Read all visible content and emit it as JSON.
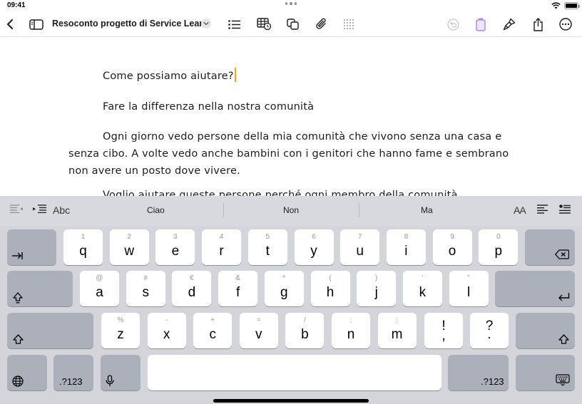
{
  "status_bar": {
    "time": "09:41"
  },
  "toolbar": {
    "document_title": "Resoconto progetto di Service Lear..."
  },
  "document": {
    "paragraphs": [
      "Come possiamo aiutare?",
      "Fare la differenza nella nostra comunità",
      "Ogni giorno vedo persone della mia comunità che vivono senza una casa e senza cibo. A volte vedo anche bambini con i genitori che hanno fame e sembrano non avere un posto dove vivere."
    ],
    "partial_paragraph": "Voglio aiutare queste persone perché ogni membro della comunità"
  },
  "keyboard": {
    "suggestions": {
      "abc_label": "Abc",
      "words": [
        "Ciao",
        "Non",
        "Ma"
      ],
      "text_size_label": "AA"
    },
    "row1": [
      {
        "main": "q",
        "sec": "1"
      },
      {
        "main": "w",
        "sec": "2"
      },
      {
        "main": "e",
        "sec": "3"
      },
      {
        "main": "r",
        "sec": "4"
      },
      {
        "main": "t",
        "sec": "5"
      },
      {
        "main": "y",
        "sec": "6"
      },
      {
        "main": "u",
        "sec": "7"
      },
      {
        "main": "i",
        "sec": "8"
      },
      {
        "main": "o",
        "sec": "9"
      },
      {
        "main": "p",
        "sec": "0"
      }
    ],
    "row2": [
      {
        "main": "a",
        "sec": "@"
      },
      {
        "main": "s",
        "sec": "#"
      },
      {
        "main": "d",
        "sec": "€"
      },
      {
        "main": "f",
        "sec": "&"
      },
      {
        "main": "g",
        "sec": "*"
      },
      {
        "main": "h",
        "sec": "("
      },
      {
        "main": "j",
        "sec": ")"
      },
      {
        "main": "k",
        "sec": "’"
      },
      {
        "main": "l",
        "sec": "”"
      }
    ],
    "row3": [
      {
        "main": "z",
        "sec": "%"
      },
      {
        "main": "x",
        "sec": "-"
      },
      {
        "main": "c",
        "sec": "+"
      },
      {
        "main": "v",
        "sec": "="
      },
      {
        "main": "b",
        "sec": "/"
      },
      {
        "main": "n",
        "sec": ";"
      },
      {
        "main": "m",
        "sec": ":"
      }
    ],
    "punct1": {
      "top": "!",
      "bottom": ","
    },
    "punct2": {
      "top": "?",
      "bottom": "."
    },
    "numbers_label_left": ".?123",
    "numbers_label_right": ".?123"
  },
  "colors": {
    "cursor": "#f2a20a",
    "accent_purple": "#b388e0",
    "keyboard_bg": "#d3d5db"
  }
}
